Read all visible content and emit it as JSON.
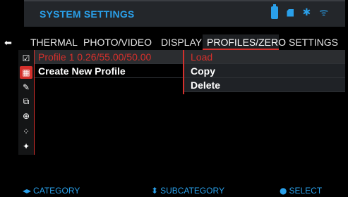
{
  "header": {
    "title": "SYSTEM SETTINGS",
    "status_icons": [
      "battery-icon",
      "sd-card-icon",
      "bluetooth-icon",
      "wifi-icon"
    ],
    "bluetooth_glyph": "✱",
    "wifi_glyph": "ᯤ"
  },
  "nav": {
    "back_glyph": "⬅",
    "tabs": [
      {
        "label": "THERMAL"
      },
      {
        "label": "PHOTO/VIDEO"
      },
      {
        "label": "DISPLAY"
      },
      {
        "label": "PROFILES/ZERO",
        "active": true
      },
      {
        "label": "SETTINGS"
      }
    ]
  },
  "side_icons": [
    {
      "name": "checkbox-icon",
      "glyph": "☑"
    },
    {
      "name": "profile-grid-icon",
      "glyph": "▦",
      "active": true
    },
    {
      "name": "edit-icon",
      "glyph": "✎"
    },
    {
      "name": "export-icon",
      "glyph": "⧉"
    },
    {
      "name": "zero-target-icon",
      "glyph": "⊕"
    },
    {
      "name": "dots-icon",
      "glyph": "⁘"
    },
    {
      "name": "reticle-icon",
      "glyph": "✦"
    }
  ],
  "profiles": {
    "items": [
      {
        "label": "Profile 1 0.26/55.00/50.00",
        "selected": true
      },
      {
        "label": "Create New Profile"
      }
    ]
  },
  "actions": {
    "items": [
      {
        "label": "Load",
        "selected": true
      },
      {
        "label": "Copy"
      },
      {
        "label": "Delete"
      }
    ]
  },
  "footer": {
    "hints": [
      {
        "glyph": "◂▸",
        "label": "CATEGORY"
      },
      {
        "glyph": "⬍",
        "label": "SUBCATEGORY"
      },
      {
        "glyph": "●",
        "label": "SELECT"
      }
    ]
  },
  "colors": {
    "accent_blue": "#2aa0ea",
    "accent_red": "#d4302c",
    "background": "#000000",
    "panel": "#23262a"
  }
}
